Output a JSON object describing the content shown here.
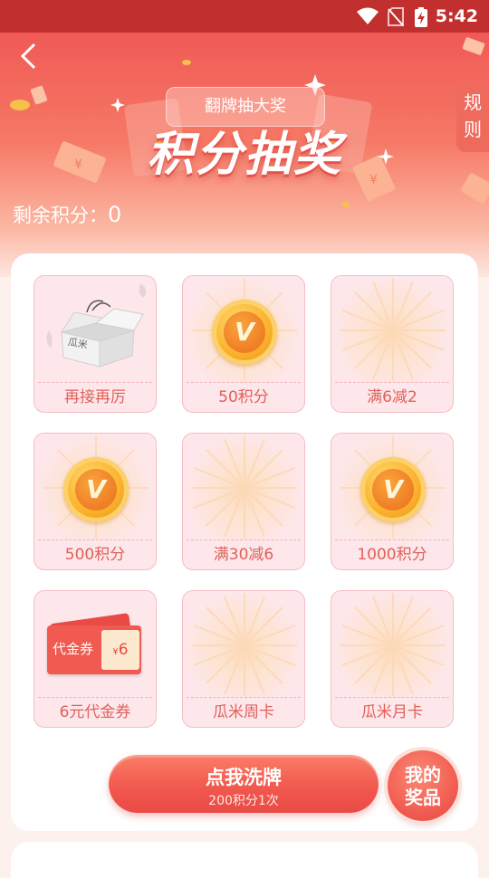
{
  "status_bar": {
    "time": "5:42"
  },
  "header": {
    "subtitle": "翻牌抽大奖",
    "title": "积分抽奖",
    "rules_line1": "规",
    "rules_line2": "则",
    "points_label": "剩余积分：",
    "points_value": "0"
  },
  "cards": [
    {
      "label": "再接再厉",
      "art": "box"
    },
    {
      "label": "50积分",
      "art": "coin",
      "coin_letter": "V"
    },
    {
      "label": "满6减2",
      "art": "rays"
    },
    {
      "label": "500积分",
      "art": "coin",
      "coin_letter": "V"
    },
    {
      "label": "满30减6",
      "art": "rays"
    },
    {
      "label": "1000积分",
      "art": "coin",
      "coin_letter": "V"
    },
    {
      "label": "6元代金券",
      "art": "voucher",
      "voucher_text": "代金券",
      "voucher_amount": "6",
      "voucher_currency": "¥"
    },
    {
      "label": "瓜米周卡",
      "art": "rays"
    },
    {
      "label": "瓜米月卡",
      "art": "rays"
    }
  ],
  "box_text": "瓜米",
  "actions": {
    "shuffle_label": "点我洗牌",
    "shuffle_cost": "200积分1次",
    "my_prizes_line1": "我的",
    "my_prizes_line2": "奖品"
  },
  "colors": {
    "accent": "#f0574e",
    "label": "#e0605a",
    "card_bg": "#fde7ea"
  }
}
